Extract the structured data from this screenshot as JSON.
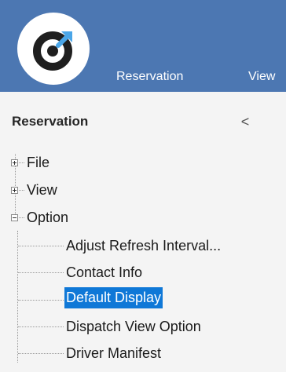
{
  "app": {
    "logo_icon": "app-logo-icon",
    "menu": {
      "reservation": "Reservation",
      "view": "View"
    }
  },
  "panel": {
    "title": "Reservation",
    "collapse_glyph": "<",
    "tree": {
      "file": "File",
      "view": "View",
      "option": "Option",
      "option_children": [
        "Adjust Refresh Interval...",
        "Contact Info",
        "Default Display",
        "Dispatch View Option",
        "Driver Manifest"
      ],
      "selected": "Default Display"
    }
  },
  "colors": {
    "ribbon": "#4c77b2",
    "selection": "#0f78d7",
    "panel_bg": "#f4f4f4"
  }
}
